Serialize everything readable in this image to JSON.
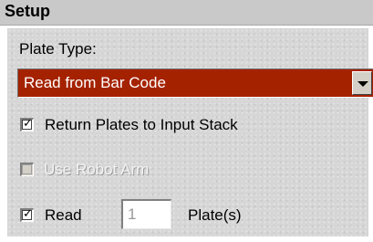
{
  "header": {
    "title": "Setup"
  },
  "plate_type": {
    "label": "Plate Type:",
    "selected": "Read from Bar Code"
  },
  "options": {
    "return_plates": {
      "label": "Return Plates to Input Stack",
      "checked": true
    },
    "use_robot_arm": {
      "label": "Use Robot Arm",
      "checked": false,
      "enabled": false
    },
    "read": {
      "label": "Read",
      "checked": true,
      "count": "1",
      "unit": "Plate(s)"
    }
  },
  "colors": {
    "dropdown_bg": "#a52200",
    "header_bg": "#c9c9c9",
    "panel_bg": "#d6d6d6"
  },
  "icons": {
    "dropdown": "chevron-down-icon",
    "check": "check-icon"
  }
}
